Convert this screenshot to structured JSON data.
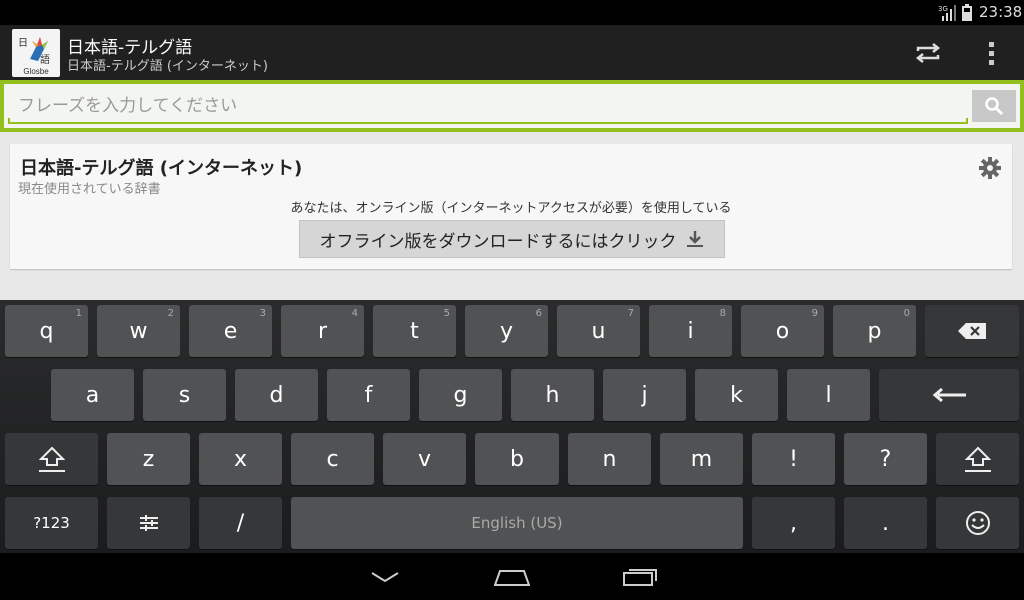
{
  "status_bar": {
    "signal_label": "3G",
    "time": "23:38"
  },
  "action_bar": {
    "app_icon_text": "Glosbe",
    "app_icon_glyph_1": "日",
    "app_icon_glyph_2": "語",
    "title": "日本語-テルグ語",
    "subtitle": "日本語-テルグ語 (インターネット)",
    "swap_icon": "swap-icon",
    "overflow_icon": "overflow-menu-icon"
  },
  "search": {
    "placeholder": "フレーズを入力してください",
    "value": "",
    "button_icon": "search-icon",
    "accent": "#93c01f"
  },
  "dictionary": {
    "title": "日本語-テルグ語 (インターネット)",
    "subtitle": "現在使用されている辞書",
    "online_note": "あなたは、オンライン版（インターネットアクセスが必要）を使用している",
    "download_label": "オフライン版をダウンロードするにはクリック",
    "download_icon": "download-icon",
    "settings_icon": "gear-icon"
  },
  "keyboard": {
    "row1": [
      {
        "label": "q",
        "hint": "1"
      },
      {
        "label": "w",
        "hint": "2"
      },
      {
        "label": "e",
        "hint": "3"
      },
      {
        "label": "r",
        "hint": "4"
      },
      {
        "label": "t",
        "hint": "5"
      },
      {
        "label": "y",
        "hint": "6"
      },
      {
        "label": "u",
        "hint": "7"
      },
      {
        "label": "i",
        "hint": "8"
      },
      {
        "label": "o",
        "hint": "9"
      },
      {
        "label": "p",
        "hint": "0"
      }
    ],
    "row2": [
      "a",
      "s",
      "d",
      "f",
      "g",
      "h",
      "j",
      "k",
      "l"
    ],
    "row3": [
      "z",
      "x",
      "c",
      "v",
      "b",
      "n",
      "m",
      "!",
      "?"
    ],
    "symbols_label": "?123",
    "slash_label": "/",
    "space_label": "English (US)",
    "comma_label": ",",
    "period_label": "."
  },
  "nav_bar": {
    "back_icon": "back-icon",
    "home_icon": "home-icon",
    "recents_icon": "recents-icon"
  }
}
